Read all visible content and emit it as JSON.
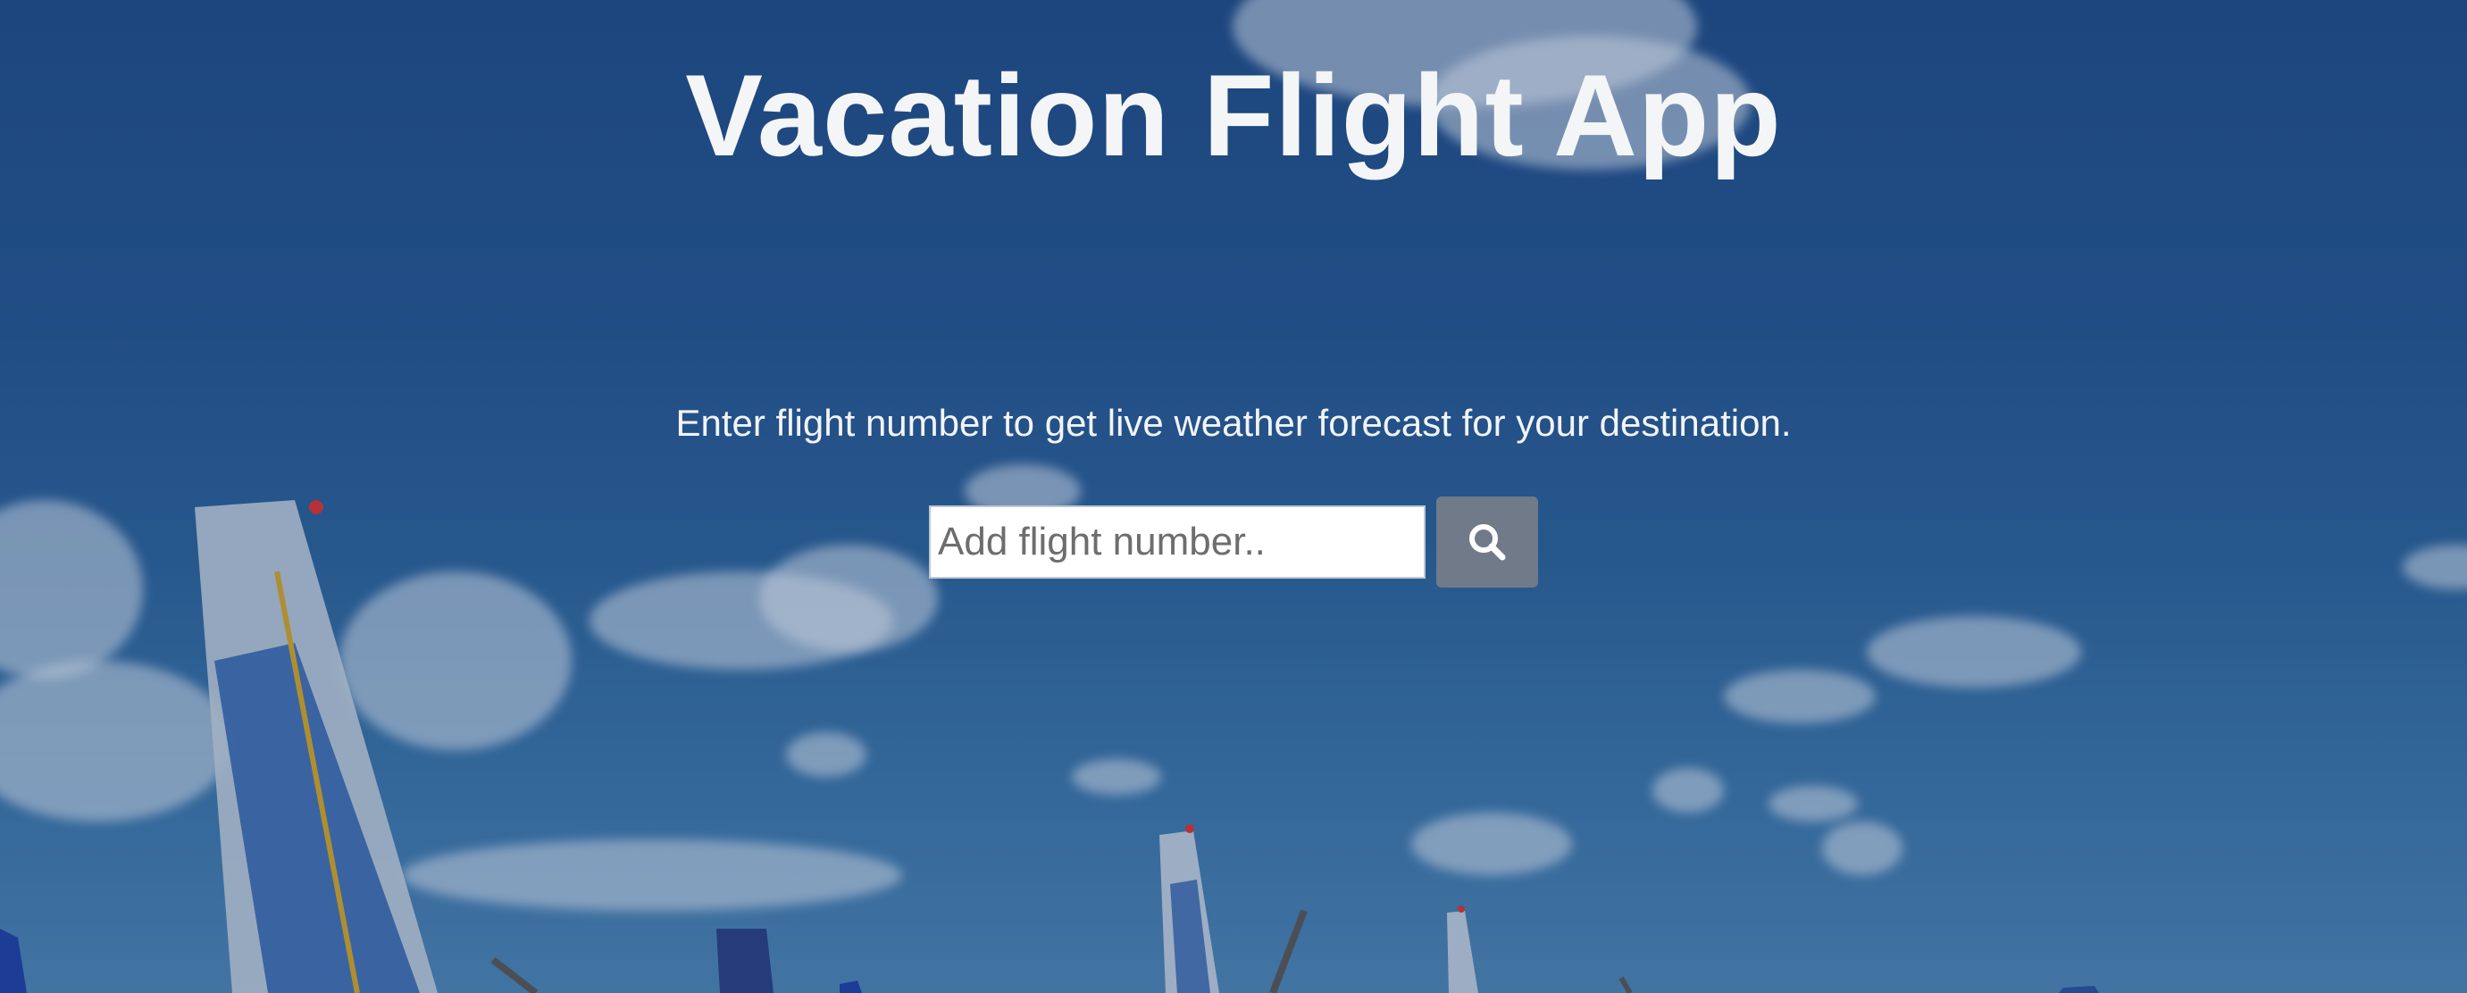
{
  "header": {
    "title": "Vacation Flight App"
  },
  "main": {
    "subtitle": "Enter flight number to get live weather forecast for your destination.",
    "search": {
      "placeholder": "Add flight number..",
      "value": "",
      "button_icon": "search-icon"
    }
  },
  "background": {
    "description_icon": "airplane-tails-photo",
    "colors": {
      "sky": "#23518c",
      "button": "#707a88",
      "text": "#f4f5f7"
    }
  }
}
